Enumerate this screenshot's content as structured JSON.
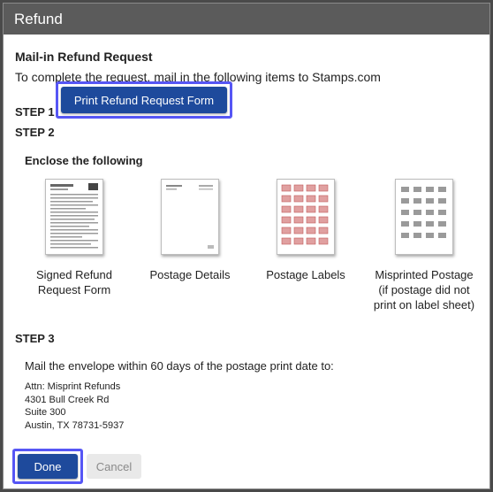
{
  "dialog": {
    "title": "Refund"
  },
  "heading": "Mail-in Refund Request",
  "intro": "To complete the request, mail in the following items to Stamps.com",
  "step1": {
    "label": "STEP 1",
    "button_label": "Print Refund Request Form"
  },
  "step2": {
    "label": "STEP 2",
    "enclose_title": "Enclose the following",
    "items": [
      {
        "label_line1": "Signed Refund",
        "label_line2": "Request Form",
        "label_line3": "",
        "icon": "refund-form-thumbnail-icon"
      },
      {
        "label_line1": "Postage Details",
        "label_line2": "",
        "label_line3": "",
        "icon": "postage-details-thumbnail-icon"
      },
      {
        "label_line1": "Postage Labels",
        "label_line2": "",
        "label_line3": "",
        "icon": "postage-labels-thumbnail-icon"
      },
      {
        "label_line1": "Misprinted Postage",
        "label_line2": "(if postage did not",
        "label_line3": "print on label sheet)",
        "icon": "misprinted-postage-thumbnail-icon"
      }
    ]
  },
  "step3": {
    "label": "STEP 3",
    "instruction": "Mail the envelope within 60 days of the postage print date to:",
    "address": {
      "line1": "Attn: Misprint Refunds",
      "line2": "4301 Bull Creek Rd",
      "line3": "Suite 300",
      "line4": "Austin, TX 78731-5937"
    }
  },
  "footer": {
    "done_label": "Done",
    "cancel_label": "Cancel"
  },
  "colors": {
    "primary": "#1e4a9c",
    "highlight": "#5656f5",
    "titlebar": "#5b5b5b"
  }
}
